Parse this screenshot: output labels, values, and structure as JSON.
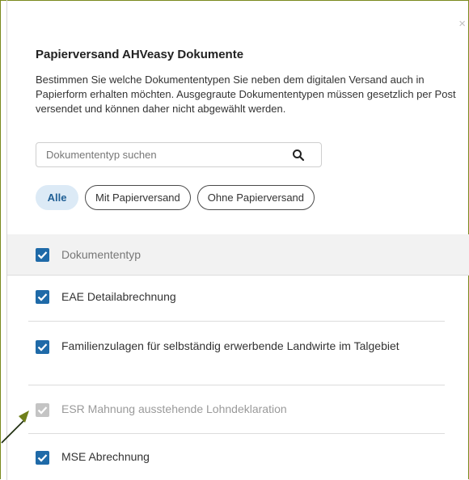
{
  "modal": {
    "close_glyph": "×",
    "title": "Papierversand AHVeasy Dokumente",
    "description": "Bestimmen Sie welche Dokumententypen Sie neben dem digitalen Versand auch in Papierform erhalten möchten. Ausgegraute Dokumententypen müssen gesetzlich per Post versendet und können daher nicht abgewählt werden."
  },
  "search": {
    "placeholder": "Dokumententyp suchen",
    "value": "",
    "icon": "search-icon"
  },
  "filters": [
    {
      "label": "Alle",
      "active": true
    },
    {
      "label": "Mit Papierversand",
      "active": false
    },
    {
      "label": "Ohne Papierversand",
      "active": false
    }
  ],
  "table": {
    "header_label": "Dokumententyp",
    "rows": [
      {
        "label": "EAE Detailabrechnung",
        "checked": true,
        "disabled": false
      },
      {
        "label": "Familienzulagen für selbständig erwerbende Landwirte im Talgebiet",
        "checked": true,
        "disabled": false
      },
      {
        "label": "ESR Mahnung ausstehende Lohndeklaration",
        "checked": true,
        "disabled": true
      },
      {
        "label": "MSE Abrechnung",
        "checked": true,
        "disabled": false
      }
    ]
  },
  "colors": {
    "accent": "#1f6aa8",
    "frame": "#7a8a1e",
    "disabled": "#c4c4c4"
  }
}
